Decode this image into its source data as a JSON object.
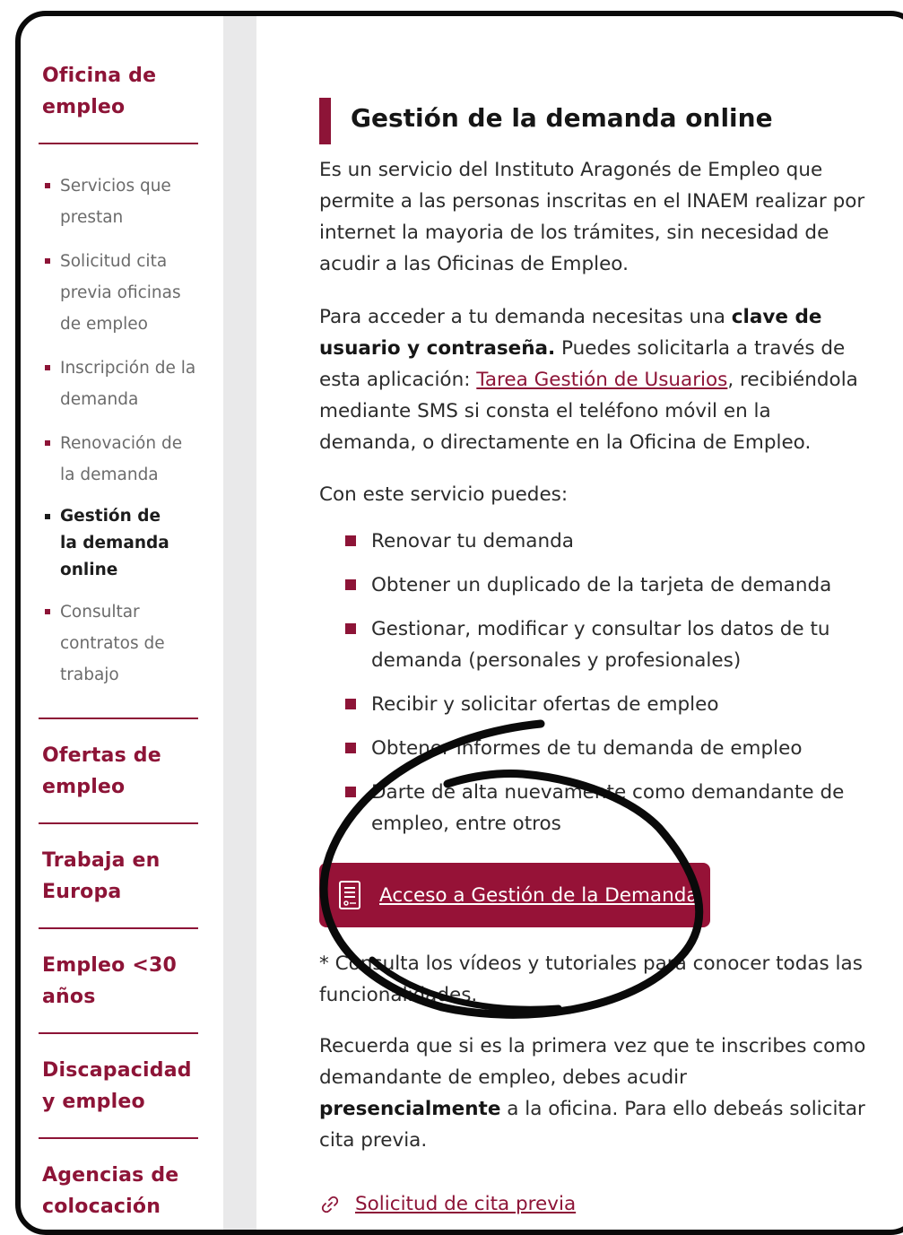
{
  "sidebar": {
    "section_office": "Oficina de empleo",
    "subnav": [
      "Servicios que prestan",
      "Solicitud cita previa oficinas de empleo",
      "Inscripción de la demanda",
      "Renovación de la demanda",
      "Gestión de la demanda online",
      "Consultar contratos de trabajo"
    ],
    "section_offers": "Ofertas de empleo",
    "section_europe": "Trabaja en Europa",
    "section_under30": "Empleo <30 años",
    "section_disability": "Discapacidad y empleo",
    "section_agencies": "Agencias de colocación"
  },
  "main": {
    "title": "Gestión de la demanda online",
    "intro": "Es un servicio del Instituto Aragonés de Empleo que permite a las personas inscritas en el INAEM realizar por internet la mayoria de los trámites, sin necesidad de acudir a las Oficinas de Empleo.",
    "access": {
      "before": "Para acceder a tu demanda necesitas una ",
      "bold": "clave de usuario y contraseña.",
      "middle": " Puedes solicitarla a través de esta aplicación: ",
      "link": "Tarea Gestión de Usuarios",
      "after": ", recibiéndola mediante SMS si consta el teléfono móvil en la demanda, o directamente en la Oficina de Empleo."
    },
    "list_intro": "Con este servicio puedes:",
    "bullets": [
      "Renovar tu demanda",
      "Obtener un duplicado de la tarjeta de demanda",
      "Gestionar, modificar y consultar los datos de tu demanda (personales y profesionales)",
      "Recibir y solicitar ofertas de empleo",
      "Obtener informes de tu demanda de empleo",
      "Darte de alta nuevamente como demandante de empleo, entre otros"
    ],
    "cta_label": "Acceso a Gestión de la Demanda",
    "tutorials_note": "* Consulta los vídeos y tutoriales para conocer todas las funcionalidades.",
    "first_time": {
      "before": "Recuerda que si es la primera vez que te inscribes como demandante de empleo, debes acudir ",
      "bold": "presencialmente",
      "after": " a la oficina. Para ello debeás solicitar cita previa."
    },
    "appointment_link": "Solicitud de cita previa"
  },
  "colors": {
    "brand": "#8d1437",
    "button": "#961237",
    "gutter": "#e9e9ea",
    "annotation": "#0a0a0a"
  },
  "icons": [
    "document-form-icon",
    "link-icon"
  ]
}
